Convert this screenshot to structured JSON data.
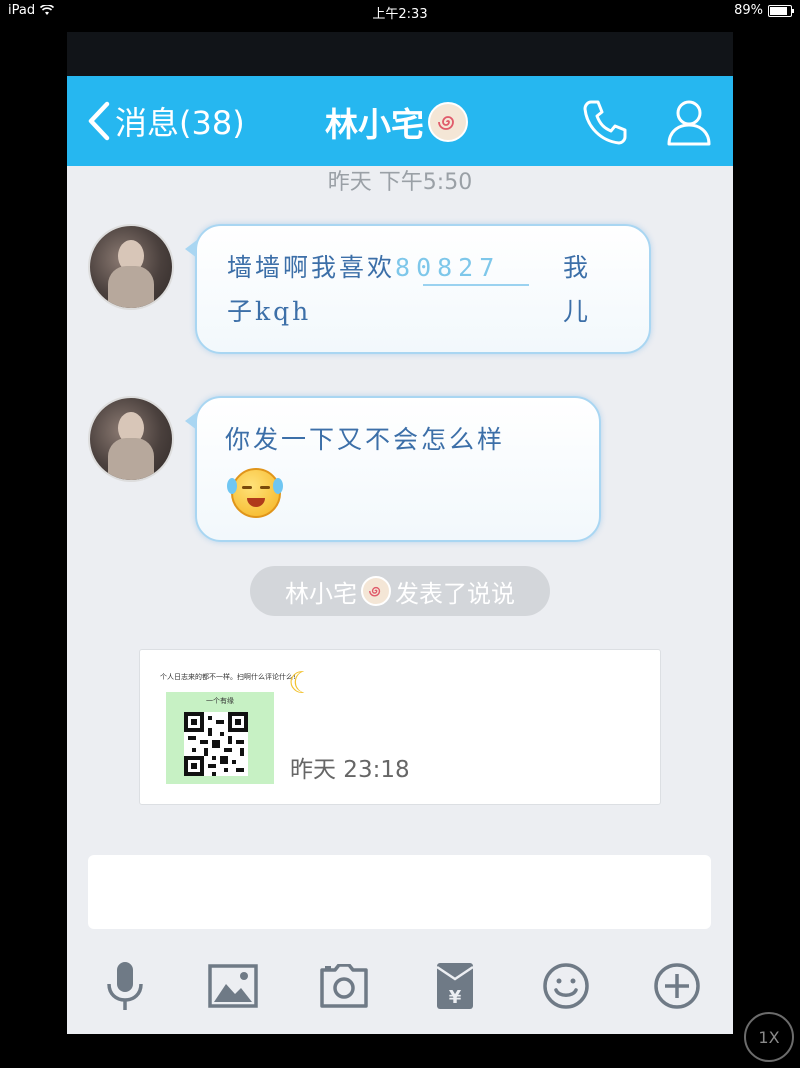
{
  "status_bar": {
    "device": "iPad",
    "time": "上午2:33",
    "battery": "89%"
  },
  "header": {
    "back_label": "消息(38)",
    "title": "林小宅"
  },
  "timestamp": "昨天 下午5:50",
  "messages": [
    {
      "line1_text": "墙墙啊我喜欢",
      "line1_number": "80827",
      "line1_end": "我",
      "line2_text": "子kqh",
      "line2_end": "儿"
    },
    {
      "line1_text": "你发一下又不会怎么样"
    }
  ],
  "notice": {
    "name": "林小宅",
    "action": "发表了说说"
  },
  "post_card": {
    "caption": "个人日志来的都不一样。扫啊什么评论什么!",
    "qr_label": "一个有缘",
    "time": "昨天 23:18"
  },
  "toolbar": {
    "items": [
      "microphone-icon",
      "image-icon",
      "camera-icon",
      "red-packet-icon",
      "emoji-icon",
      "plus-icon"
    ]
  },
  "zoom_badge": "1X",
  "colors": {
    "nav": "#26b7f0",
    "bubble_text": "#3c6fa8",
    "bubble_border": "#a9d6f2"
  }
}
